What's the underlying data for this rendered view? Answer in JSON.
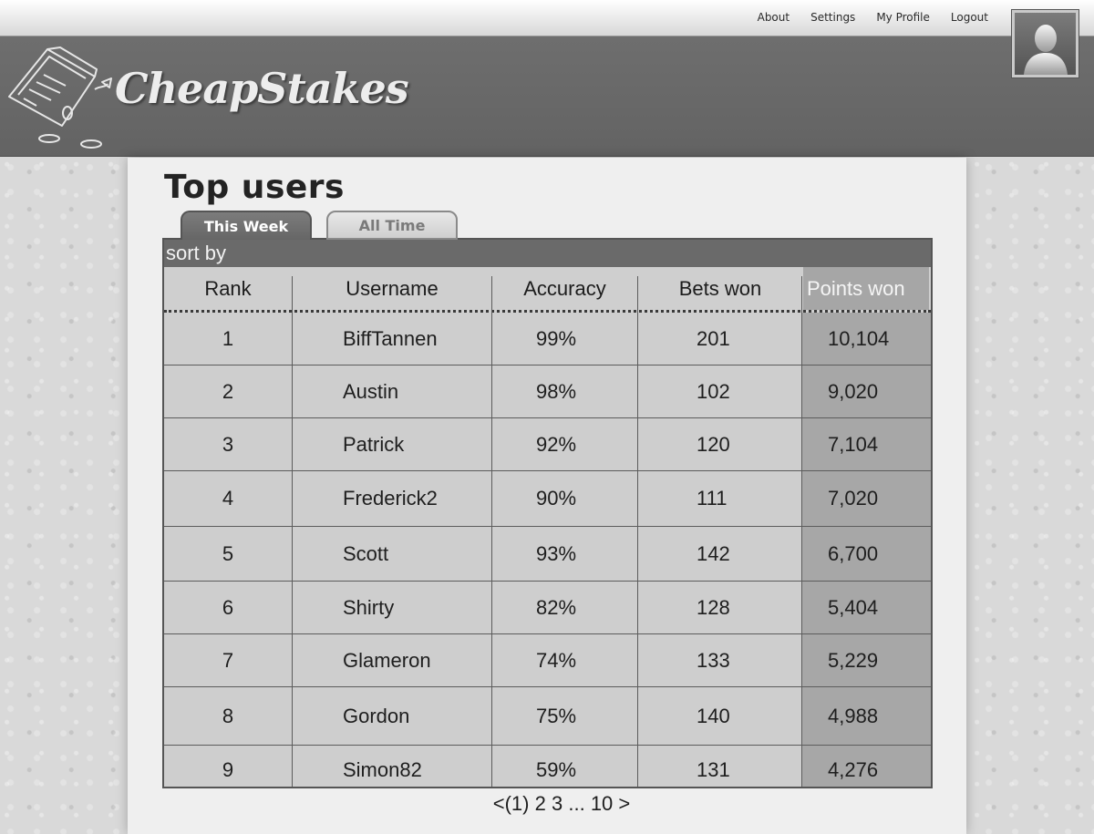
{
  "nav": {
    "links": [
      "About",
      "Settings",
      "My Profile",
      "Logout"
    ]
  },
  "brand": {
    "name": "CheapStakes"
  },
  "page": {
    "title": "Top users"
  },
  "tabs": [
    {
      "label": "This Week",
      "active": true
    },
    {
      "label": "All Time",
      "active": false
    }
  ],
  "table": {
    "sort_label": "sort by",
    "columns": [
      "Rank",
      "Username",
      "Accuracy",
      "Bets won",
      "Points won"
    ],
    "sorted_column": "Points won",
    "rows": [
      {
        "rank": "1",
        "username": "BiffTannen",
        "accuracy": "99%",
        "bets": "201",
        "points": "10,104"
      },
      {
        "rank": "2",
        "username": "Austin",
        "accuracy": "98%",
        "bets": "102",
        "points": "9,020"
      },
      {
        "rank": "3",
        "username": "Patrick",
        "accuracy": "92%",
        "bets": "120",
        "points": "7,104"
      },
      {
        "rank": "4",
        "username": "Frederick2",
        "accuracy": "90%",
        "bets": "111",
        "points": "7,020"
      },
      {
        "rank": "5",
        "username": "Scott",
        "accuracy": "93%",
        "bets": "142",
        "points": "6,700"
      },
      {
        "rank": "6",
        "username": "Shirty",
        "accuracy": "82%",
        "bets": "128",
        "points": "5,404"
      },
      {
        "rank": "7",
        "username": "Glameron",
        "accuracy": "74%",
        "bets": "133",
        "points": "5,229"
      },
      {
        "rank": "8",
        "username": "Gordon",
        "accuracy": "75%",
        "bets": "140",
        "points": "4,988"
      },
      {
        "rank": "9",
        "username": "Simon82",
        "accuracy": "59%",
        "bets": "131",
        "points": "4,276"
      }
    ]
  },
  "pagination": {
    "prev": "<",
    "current": "(1)",
    "pages": [
      "2",
      "3",
      "...",
      "10"
    ],
    "next": ">"
  },
  "icons": {
    "avatar": "user-silhouette-icon",
    "logo": "ticket-sketch-icon"
  }
}
